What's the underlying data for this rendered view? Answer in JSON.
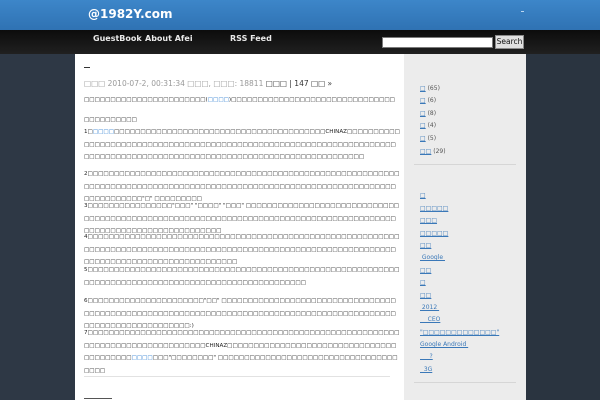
{
  "site": {
    "title": "@1982Y.com"
  },
  "nav": {
    "items": [
      {
        "label": "GuestBook"
      },
      {
        "label": "About Afei"
      },
      {
        "label": "RSS Feed"
      }
    ]
  },
  "search": {
    "button_label": "Search",
    "value": ""
  },
  "post": {
    "meta_date": "□□□ 2010-07-2, 00:31:34 □□□, □□□: 18811",
    "meta_tags": "□□□ | 147 □□ »",
    "intro": {
      "before": "□□□□□□□□□□□□□□□□□□□□□□□(",
      "highlight": "□□□□",
      "after": ")□□□□□□□□□□□□□□□□□□□□□□□□□□□□□□□"
    },
    "section_heading": "□□□□□□□□□□",
    "p1": {
      "before": "1□",
      "highlight": "□□□□",
      "after": "□□□□□□□□□□□□□□□□□□□□□□□□□□□□□□□□□□□□□□□□CHINAZ□□□□□□□□□□□□□□□□□□□□□□□□□□□□□□□□□□□□□□□□□□□□□□□□□□□□□□□□□□□□□□□□□□□□□□□□□□□□□□□□□□□□□□□□□□□□□□□□□□□□□□□□□□□□□□□□□□□□□□□□□□"
    },
    "p2": "2□□□□□□□□□□□□□□□□□□□□□□□□□□□□□□□□□□□□□□□□□□□□□□□□□□□□□□□□□□□□□□□□□□□□□□□□□□□□□□□□□□□□□□□□□□□□□□□□□□□□□□□□□□□□□□□□□□□□□□□□□□□□□□□□□\"□\" □□□□□□□□□",
    "p3": "3□□□□□□□□□□□□□□□□\"□□□\" \"□□□□\" \"□□□\" □□□□□□□□□□□□□□□□□□□□□□□□□□□□□□□□□□□□□□□□□□□□□□□□□□□□□□□□□□□□□□□□□□□□□□□□□□□□□□□□□□□□□□□□□□□□□□□□□□□□□□□□□□□□□□□□□□",
    "p4": "4□□□□□□□□□□□□□□□□□□□□□□□□□□□□□□□□□□□□□□□□□□□□□□□□□□□□□□□□□□□□□□□□□□□□□□□□□□□□□□□□□□□□□□□□□□□□□□□□□□□□□□□□□□□□□□□□□□□□□□□□□□□□□□□□□□□□□□□□□□□□□□□□□□□",
    "p5": "5□□□□□□□□□□□□□□□□□□□□□□□□□□□□□□□□□□□□□□□□□□□□□□□□□□□□□□□□□□□□□□□□□□□□□□□□□□□□□□□□□□□□□□□□□□□□□□□□□□□□□",
    "p6": "6□□□□□□□□□□□□□□□□□□□□□□\"□□\" □□□□□□□□□□□□□□□□□□□□□□□□□□□□□□□□□□□□□□□□□□□□□□□□□□□□□□□□□□□□□□□□□□□□□□□□□□□□□□□□□□□□□□□□□□□□□□□□□□□□□□□□□□□□□□□□:)",
    "p7": {
      "before": "7□□□□□□□□□□□□□□□□□□□□□□□□□□□□□□□□□□□□□□□□□□□□□□□□□□□□□□□□□□□□□□□□□□□□□□□□□□□□□□□□□□CHINAZ□□□□□□□□□□□□□□□□□□□□□□□□□□□□□□□□□□□□□□□□□",
      "highlight": "□□□□",
      "after": "□□□\"□□□□□□□□\" □□□□□□□□□□□□□□□□□□□□□□□□□□□□□□□□□□□□□□"
    }
  },
  "sidebar": {
    "categories": [
      {
        "label": "□",
        "count": "(65)"
      },
      {
        "label": "□",
        "count": "(6)"
      },
      {
        "label": "□",
        "count": "(8)"
      },
      {
        "label": "□",
        "count": "(4)"
      },
      {
        "label": "□",
        "count": "(5)"
      },
      {
        "label": "□□",
        "count": "(29)"
      }
    ],
    "posts": [
      {
        "label": "□"
      },
      {
        "label": "□□□□□"
      },
      {
        "label": "□□□"
      },
      {
        "label": "□□□□□"
      },
      {
        "label": "□□"
      },
      {
        "label": " Google "
      },
      {
        "label": "□□"
      },
      {
        "label": "□"
      },
      {
        "label": "□□"
      },
      {
        "label": " 2012 "
      },
      {
        "label": "    CEO"
      },
      {
        "label": "\"□□□□□□□□□□□□□\""
      },
      {
        "label": "Google Android "
      },
      {
        "label": "     ?"
      },
      {
        "label": "  3G"
      }
    ]
  }
}
